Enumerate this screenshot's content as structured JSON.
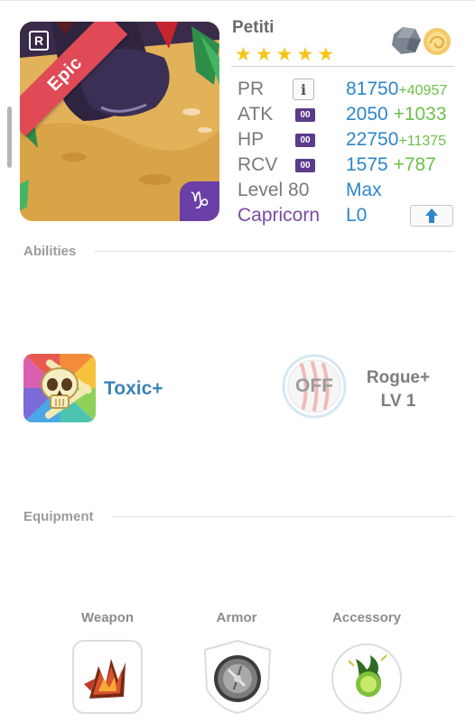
{
  "hero": {
    "name": "Petiti",
    "rarity": "Epic",
    "rank_badge": "R",
    "star_count": 5,
    "zodiac_symbol": "♑",
    "type_icons": [
      "stone-element-icon",
      "light-element-icon"
    ]
  },
  "stats": {
    "pr": {
      "label": "PR",
      "value": "81750",
      "bonus": "+40957"
    },
    "atk": {
      "label": "ATK",
      "badge": "00",
      "value": "2050",
      "bonus": "+1033"
    },
    "hp": {
      "label": "HP",
      "badge": "00",
      "value": "22750",
      "bonus": "+11375"
    },
    "rcv": {
      "label": "RCV",
      "badge": "00",
      "value": "1575",
      "bonus": "+787"
    },
    "level": {
      "label": "Level 80",
      "value": "Max"
    },
    "zodiac": {
      "label": "Capricorn",
      "value": "L0"
    }
  },
  "sections": {
    "abilities": "Abilities",
    "equipment": "Equipment"
  },
  "abilities": {
    "active_name": "Toxic+",
    "passive_state": "OFF",
    "passive_name": "Rogue+",
    "passive_level": "LV 1"
  },
  "equipment": {
    "weapon": "Weapon",
    "armor": "Armor",
    "accessory": "Accessory"
  },
  "colors": {
    "stat_value": "#2d86c9",
    "stat_bonus": "#6cc04a",
    "rarity_ribbon": "#e04a56",
    "zodiac": "#7a4aa6"
  }
}
